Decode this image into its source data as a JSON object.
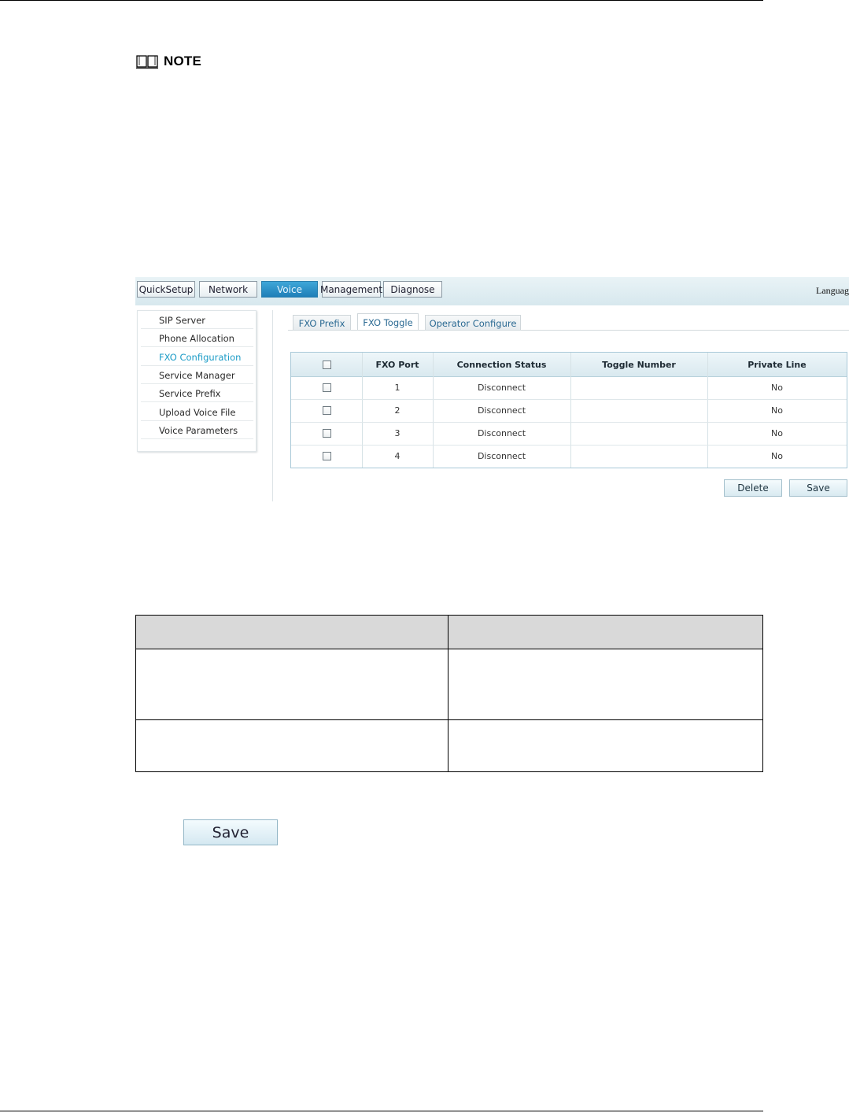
{
  "note": {
    "label": "NOTE",
    "icon": "book-icon"
  },
  "screenshot": {
    "nav": [
      "QuickSetup",
      "Network",
      "Voice",
      "Management",
      "Diagnose"
    ],
    "nav_active": "Voice",
    "language": "Languag",
    "side_menu": [
      "SIP Server",
      "Phone Allocation",
      "FXO Configuration",
      "Service Manager",
      "Service Prefix",
      "Upload Voice File",
      "Voice Parameters"
    ],
    "side_active": "FXO Configuration",
    "tabs": [
      "FXO Prefix",
      "FXO Toggle",
      "Operator Configure"
    ],
    "tab_active": "FXO Toggle",
    "grid": {
      "columns": [
        "FXO Port",
        "Connection Status",
        "Toggle Number",
        "Private Line"
      ],
      "rows": [
        {
          "port": "1",
          "status": "Disconnect",
          "toggle": "",
          "private": "No"
        },
        {
          "port": "2",
          "status": "Disconnect",
          "toggle": "",
          "private": "No"
        },
        {
          "port": "3",
          "status": "Disconnect",
          "toggle": "",
          "private": "No"
        },
        {
          "port": "4",
          "status": "Disconnect",
          "toggle": "",
          "private": "No"
        }
      ]
    },
    "buttons": {
      "delete": "Delete",
      "save": "Save"
    }
  },
  "save_button": "Save",
  "colors": {
    "active_nav": "#1f7fb8",
    "active_menu_text": "#1c9cc7",
    "header_gray": "#d9d9d9"
  }
}
